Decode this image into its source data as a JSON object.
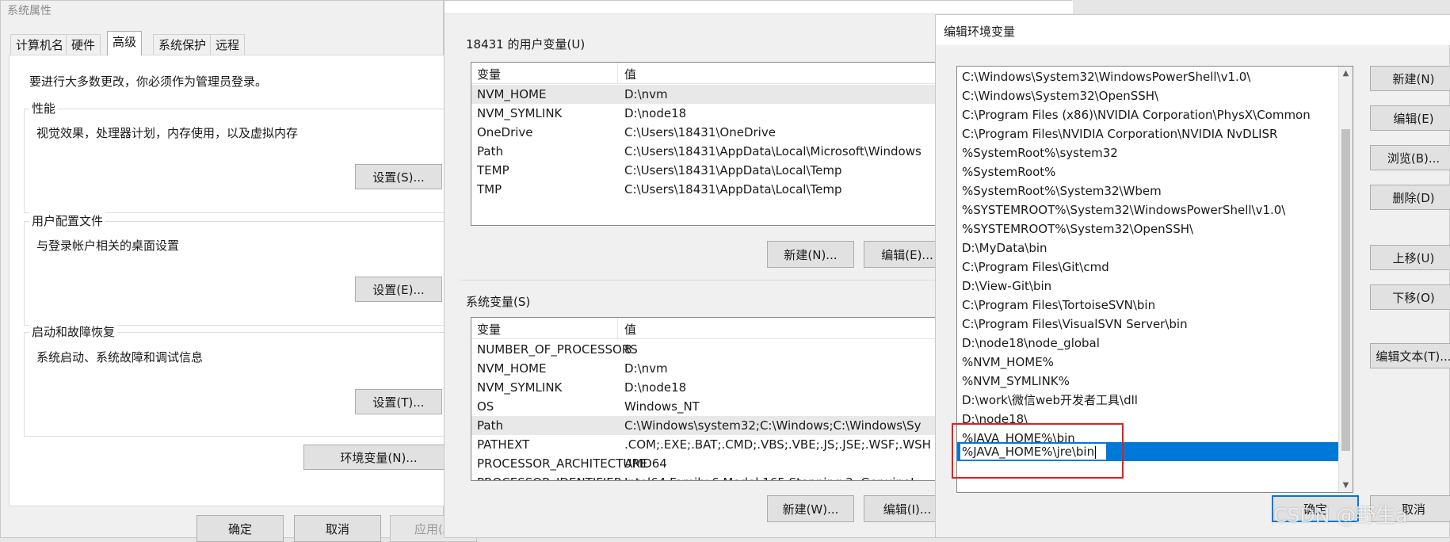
{
  "sysprops": {
    "title": "系统属性",
    "tabs": [
      "计算机名",
      "硬件",
      "高级",
      "系统保护",
      "远程"
    ],
    "admin_note": "要进行大多数更改，你必须作为管理员登录。",
    "performance": {
      "title": "性能",
      "desc": "视觉效果，处理器计划，内存使用，以及虚拟内存",
      "button": "设置(S)..."
    },
    "profile": {
      "title": "用户配置文件",
      "desc": "与登录帐户相关的桌面设置",
      "button": "设置(E)..."
    },
    "startup": {
      "title": "启动和故障恢复",
      "desc": "系统启动、系统故障和调试信息",
      "button": "设置(T)..."
    },
    "env_button": "环境变量(N)...",
    "ok": "确定",
    "cancel": "取消",
    "apply": "应用(A)"
  },
  "envvars": {
    "user_group": "18431 的用户变量(U)",
    "col_var": "变量",
    "col_val": "值",
    "user_rows": [
      {
        "name": "NVM_HOME",
        "value": "D:\\nvm"
      },
      {
        "name": "NVM_SYMLINK",
        "value": "D:\\node18"
      },
      {
        "name": "OneDrive",
        "value": "C:\\Users\\18431\\OneDrive"
      },
      {
        "name": "Path",
        "value": "C:\\Users\\18431\\AppData\\Local\\Microsoft\\Windows"
      },
      {
        "name": "TEMP",
        "value": "C:\\Users\\18431\\AppData\\Local\\Temp"
      },
      {
        "name": "TMP",
        "value": "C:\\Users\\18431\\AppData\\Local\\Temp"
      }
    ],
    "user_new": "新建(N)...",
    "user_edit": "编辑(E)...",
    "sys_group": "系统变量(S)",
    "sys_rows": [
      {
        "name": "NUMBER_OF_PROCESSORS",
        "value": "8"
      },
      {
        "name": "NVM_HOME",
        "value": "D:\\nvm"
      },
      {
        "name": "NVM_SYMLINK",
        "value": "D:\\node18"
      },
      {
        "name": "OS",
        "value": "Windows_NT"
      },
      {
        "name": "Path",
        "value": "C:\\Windows\\system32;C:\\Windows;C:\\Windows\\Sy"
      },
      {
        "name": "PATHEXT",
        "value": ".COM;.EXE;.BAT;.CMD;.VBS;.VBE;.JS;.JSE;.WSF;.WSH"
      },
      {
        "name": "PROCESSOR_ARCHITECTURE",
        "value": "AMD64"
      },
      {
        "name": "PROCESSOR_IDENTIFIER",
        "value": "Intel64 Family 6 Model 165 Stepping 2, GenuineI"
      }
    ],
    "sys_new": "新建(W)...",
    "sys_edit": "编辑(I)..."
  },
  "editenv": {
    "title": "编辑环境变量",
    "paths": [
      "C:\\Windows\\System32\\WindowsPowerShell\\v1.0\\",
      "C:\\Windows\\System32\\OpenSSH\\",
      "C:\\Program Files (x86)\\NVIDIA Corporation\\PhysX\\Common",
      "C:\\Program Files\\NVIDIA Corporation\\NVIDIA NvDLISR",
      "%SystemRoot%\\system32",
      "%SystemRoot%",
      "%SystemRoot%\\System32\\Wbem",
      "%SYSTEMROOT%\\System32\\WindowsPowerShell\\v1.0\\",
      "%SYSTEMROOT%\\System32\\OpenSSH\\",
      "D:\\MyData\\bin",
      "C:\\Program Files\\Git\\cmd",
      "D:\\View-Git\\bin",
      "C:\\Program Files\\TortoiseSVN\\bin",
      "C:\\Program Files\\VisualSVN Server\\bin",
      "D:\\node18\\node_global",
      "%NVM_HOME%",
      "%NVM_SYMLINK%",
      "D:\\work\\微信web开发者工具\\dll",
      "D:\\node18\\",
      "%JAVA_HOME%\\bin"
    ],
    "editing_value": "%JAVA_HOME%\\jre\\bin",
    "buttons": {
      "new": "新建(N)",
      "edit": "编辑(E)",
      "browse": "浏览(B)...",
      "delete": "删除(D)",
      "up": "上移(U)",
      "down": "下移(O)",
      "edit_text": "编辑文本(T)..."
    },
    "ok": "确定",
    "cancel": "取消",
    "watermark": "CSDN @野生a"
  },
  "colors": {
    "selection": "#0078d7",
    "highlight_box": "#e02020"
  }
}
